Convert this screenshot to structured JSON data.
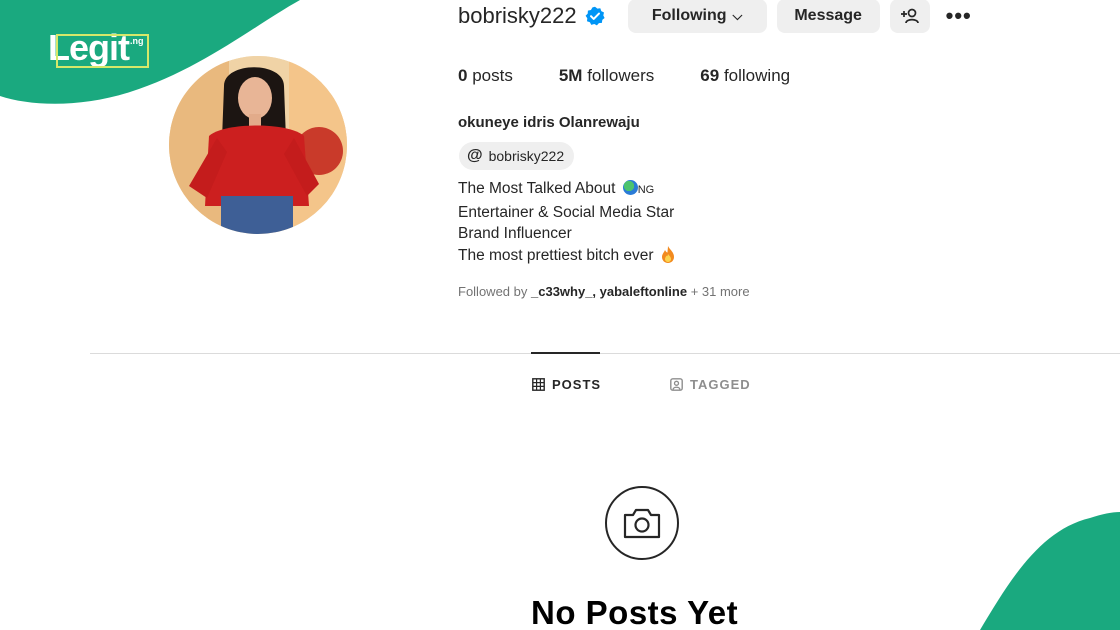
{
  "branding": {
    "logo_text": "Legit",
    "logo_suffix": ".ng",
    "brand_color": "#1aa97f"
  },
  "profile": {
    "username": "bobrisky222",
    "verified": true,
    "buttons": {
      "following": "Following",
      "message": "Message"
    },
    "stats": {
      "posts_count": "0",
      "posts_label": "posts",
      "followers_count": "5M",
      "followers_label": "followers",
      "following_count": "69",
      "following_label": "following"
    },
    "full_name": "okuneye idris Olanrewaju",
    "threads_handle": "bobrisky222",
    "bio": {
      "line1": "The Most Talked About",
      "line1_suffix": "NG",
      "line2": "Entertainer & Social Media Star",
      "line3": "Brand Influencer",
      "line4": "The most prettiest bitch ever"
    },
    "followed_by": {
      "prefix": "Followed by",
      "users": "_c33why_, yabaleftonline",
      "more": "+ 31 more"
    }
  },
  "tabs": [
    {
      "label": "POSTS",
      "icon": "grid-icon",
      "active": true
    },
    {
      "label": "TAGGED",
      "icon": "tagged-icon",
      "active": false
    }
  ],
  "empty_state": {
    "icon": "camera-icon",
    "title": "No Posts Yet"
  },
  "colors": {
    "text": "#262626",
    "muted": "#737373",
    "button_bg": "#efefef",
    "verified": "#0095f6"
  }
}
